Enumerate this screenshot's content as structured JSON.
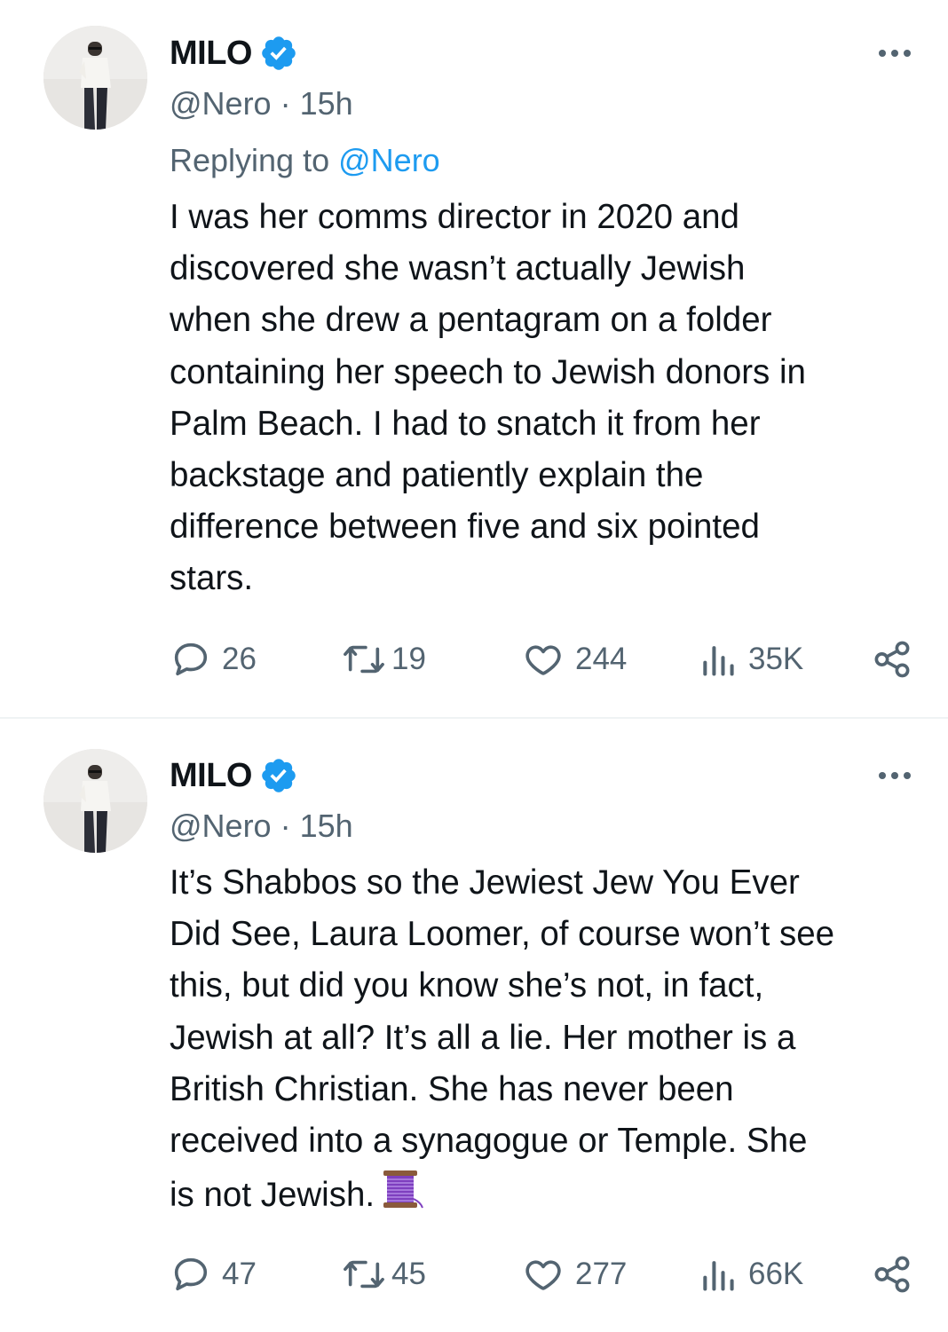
{
  "tweets": [
    {
      "author": "MILO",
      "handle": "@Nero",
      "separator": "·",
      "time": "15h",
      "replying_prefix": "Replying to",
      "replying_to": "@Nero",
      "text": "I was her comms director in 2020 and\ndiscovered she wasn’t actually Jewish\nwhen she drew a pentagram on a folder\ncontaining her speech to Jewish donors in\nPalm Beach. I had to snatch it from her\nbackstage and patiently explain the\ndifference between five and six pointed\nstars.",
      "emoji_icon": "",
      "replies": "26",
      "retweets": "19",
      "likes": "244",
      "views": "35K"
    },
    {
      "author": "MILO",
      "handle": "@Nero",
      "separator": "·",
      "time": "15h",
      "text": "It’s Shabbos so the Jewiest Jew You Ever\nDid See, Laura Loomer, of course won’t see\nthis, but did you know she’s not, in fact,\nJewish at all? It’s all a lie. Her mother is a\nBritish Christian. She has never been\nreceived into a synagogue or Temple. She\nis not Jewish.",
      "emoji_icon": "thread-spool-icon",
      "replies": "47",
      "retweets": "45",
      "likes": "277",
      "views": "66K"
    }
  ],
  "colors": {
    "text": "#0f1419",
    "secondary": "#536471",
    "accent": "#1d9bf0",
    "divider": "#eff3f4",
    "thread_spool": "#7e3fbf"
  },
  "icons": [
    "reply-icon",
    "retweet-icon",
    "like-icon",
    "views-icon",
    "share-icon",
    "more-icon",
    "verified-badge-icon"
  ]
}
